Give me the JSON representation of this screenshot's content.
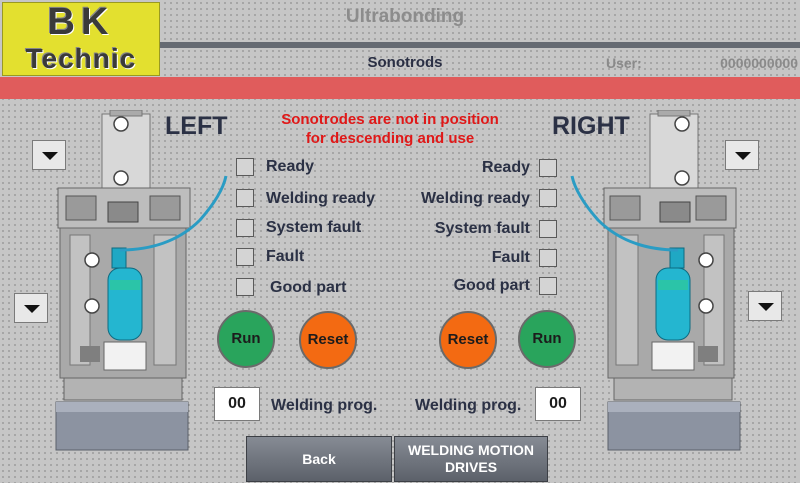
{
  "header": {
    "logo_line1": "BK",
    "logo_line2": "Technic",
    "app_title": "Ultrabonding",
    "page_title": "Sonotrods",
    "user_label": "User:",
    "user_value": "0000000000"
  },
  "warning": {
    "line1": "Sonotrodes are not in position",
    "line2": "for descending and use"
  },
  "left": {
    "heading": "LEFT",
    "status": [
      "Ready",
      "Welding ready",
      "System fault",
      "Fault",
      "Good part"
    ],
    "run_label": "Run",
    "reset_label": "Reset",
    "prog_label": "Welding prog.",
    "prog_value": "00"
  },
  "right": {
    "heading": "RIGHT",
    "status": [
      "Ready",
      "Welding ready",
      "System fault",
      "Fault",
      "Good part"
    ],
    "run_label": "Run",
    "reset_label": "Reset",
    "prog_label": "Welding prog.",
    "prog_value": "00"
  },
  "nav": {
    "back_label": "Back",
    "motion_line1": "WELDING MOTION",
    "motion_line2": "DRIVES"
  },
  "colors": {
    "alarm_bar": "#e05c5c",
    "run": "#29a45c",
    "reset": "#f36a12",
    "warning_text": "#e01818",
    "logo_yellow": "#e3e02f"
  },
  "icons": {
    "arrow": "triangle-down",
    "machine": "sonotrode-machine-illustration"
  }
}
